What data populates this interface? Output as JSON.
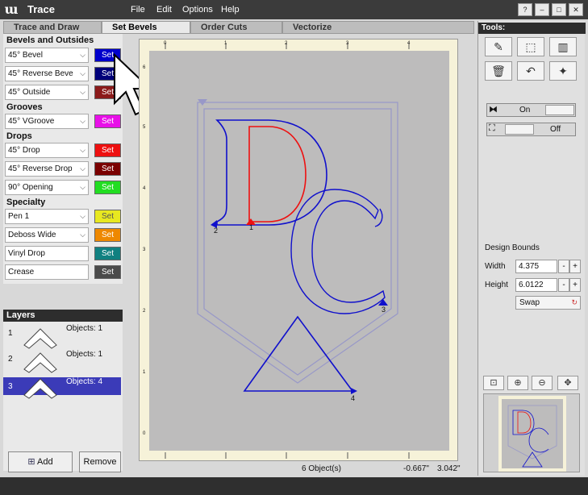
{
  "app": {
    "title": "Trace",
    "logo_glyph": "ա"
  },
  "menu": [
    "File",
    "Edit",
    "Options",
    "Help"
  ],
  "window_buttons": [
    "?",
    "–",
    "□",
    "✕"
  ],
  "tabs": [
    "Trace and Draw",
    "Set Bevels",
    "Order Cuts",
    "Vectorize"
  ],
  "active_tab": "Set Bevels",
  "sections": {
    "bevels": "Bevels and Outsides",
    "grooves": "Grooves",
    "drops": "Drops",
    "specialty": "Specialty"
  },
  "set_label": "Set",
  "bevel_rows": [
    {
      "value": "45° Bevel",
      "color": "#0000cc"
    },
    {
      "value": "45° Reverse Beve",
      "color": "#00007a"
    },
    {
      "value": "45° Outside",
      "color": "#8b1a1a"
    }
  ],
  "groove_rows": [
    {
      "value": "45° VGroove",
      "color": "#e810e8"
    }
  ],
  "drop_rows": [
    {
      "value": "45° Drop",
      "color": "#ee1010"
    },
    {
      "value": "45° Reverse Drop",
      "color": "#7a0000"
    },
    {
      "value": "90° Opening",
      "color": "#22dd22"
    }
  ],
  "specialty_rows": [
    {
      "value": "Pen 1",
      "color": "#e8e820",
      "dropdown": true
    },
    {
      "value": "Deboss Wide",
      "color": "#ee8800",
      "dropdown": true
    },
    {
      "value": "Vinyl Drop",
      "color": "#108080",
      "dropdown": false
    },
    {
      "value": "Crease",
      "color": "#4a4a4a",
      "dropdown": false
    }
  ],
  "layers": {
    "title": "Layers",
    "items": [
      {
        "num": "1",
        "objects": "Objects: 1"
      },
      {
        "num": "2",
        "objects": "Objects: 1"
      },
      {
        "num": "3",
        "objects": "Objects: 4"
      }
    ],
    "selected": "3",
    "add_label": "Add",
    "remove_label": "Remove"
  },
  "ruler": {
    "top": [
      "0",
      "1",
      "2",
      "3",
      "4"
    ],
    "side": [
      "6",
      "5",
      "4",
      "3",
      "2",
      "1",
      "0"
    ]
  },
  "canvas": {
    "markers": [
      "1",
      "2",
      "3",
      "4"
    ],
    "colors": {
      "blue": "#1010cc",
      "red": "#ee1010",
      "guide": "#9898c8"
    }
  },
  "status": {
    "objects": "6 Object(s)",
    "x": "-0.667\"",
    "y": "3.042\""
  },
  "tools": {
    "title": "Tools:",
    "buttons": [
      "knife-icon",
      "select-box-icon",
      "ruler-icon",
      "trash-icon",
      "undo-icon",
      "magic-select-icon"
    ],
    "toggle1": {
      "label": "On",
      "icon": "mirror-icon"
    },
    "toggle2": {
      "label": "Off",
      "icon": "bounds-icon"
    },
    "bounds": {
      "title": "Design Bounds",
      "width_label": "Width",
      "width": "4.375",
      "height_label": "Height",
      "height": "6.0122",
      "swap": "Swap"
    },
    "minus": "-",
    "plus": "+",
    "zoom_buttons": [
      "zoom-fit-icon",
      "zoom-in-icon",
      "zoom-out-icon",
      "zoom-pan-icon"
    ]
  }
}
